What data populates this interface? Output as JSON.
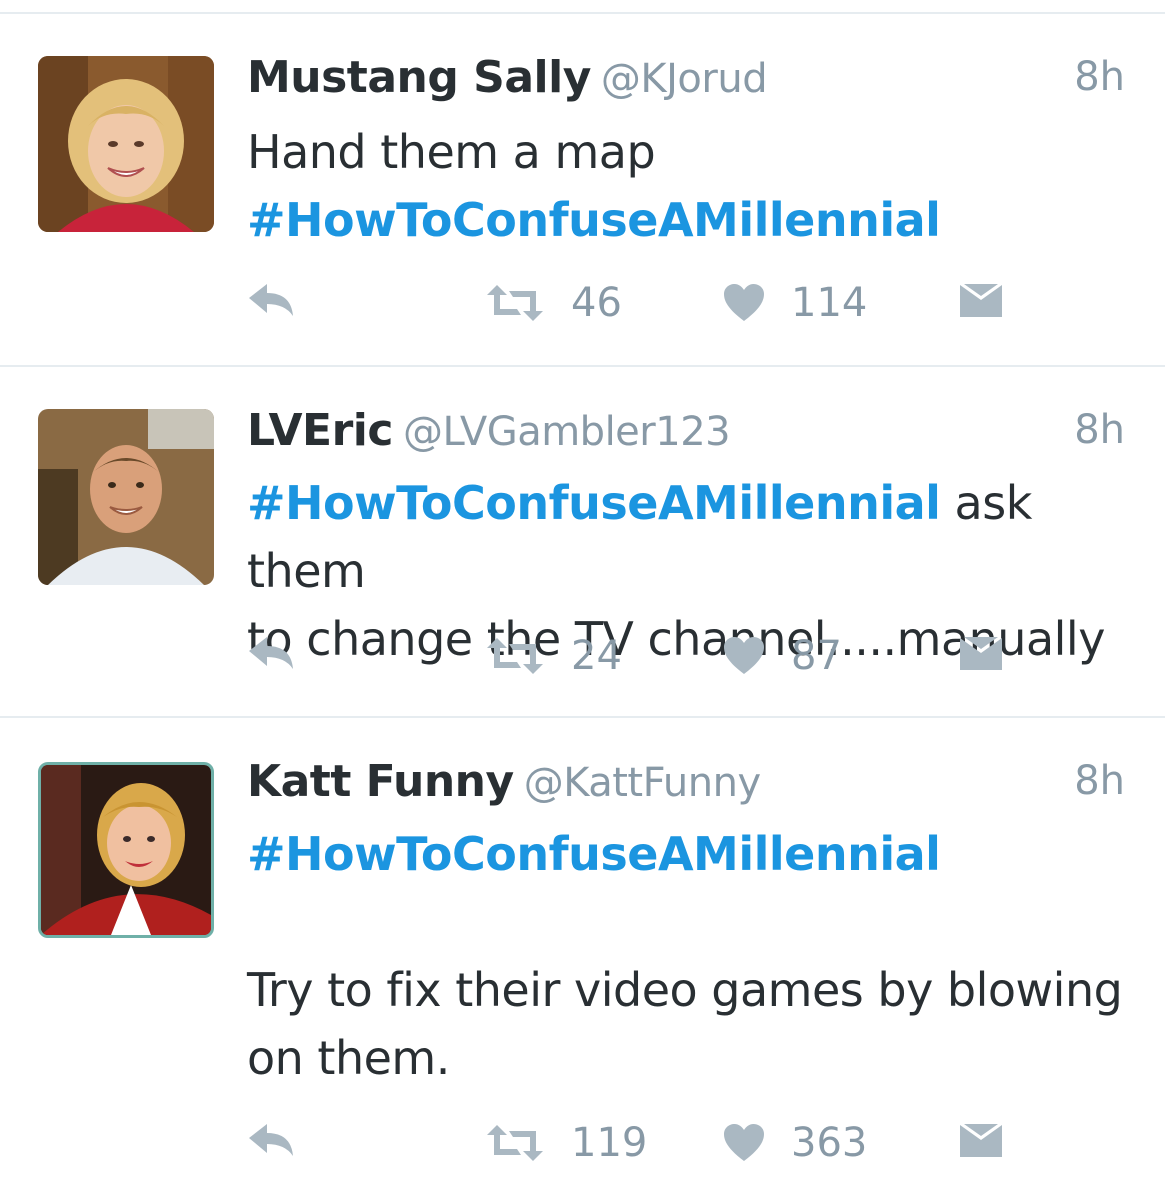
{
  "tweets": [
    {
      "name": "Mustang Sally",
      "handle": "@KJorud",
      "time": "8h",
      "lines": [
        {
          "parts": [
            {
              "text": "Hand them a map",
              "hashtag": false
            }
          ]
        },
        {
          "parts": [
            {
              "text": "#HowToConfuseAMillennial",
              "hashtag": true
            }
          ]
        }
      ],
      "retweets": "46",
      "likes": "114"
    },
    {
      "name": "LVEric",
      "handle": "@LVGambler123",
      "time": "8h",
      "lines": [
        {
          "parts": [
            {
              "text": "#HowToConfuseAMillennial",
              "hashtag": true
            },
            {
              "text": " ask them",
              "hashtag": false
            }
          ]
        },
        {
          "parts": [
            {
              "text": "to change the TV channel.....manually",
              "hashtag": false
            }
          ]
        }
      ],
      "retweets": "24",
      "likes": "87"
    },
    {
      "name": "Katt Funny",
      "handle": "@KattFunny",
      "time": "8h",
      "lines": [
        {
          "parts": [
            {
              "text": "#HowToConfuseAMillennial",
              "hashtag": true
            }
          ]
        },
        {
          "parts": [
            {
              "text": "",
              "hashtag": false
            }
          ]
        },
        {
          "parts": [
            {
              "text": "Try to fix their video games by blowing",
              "hashtag": false
            }
          ]
        },
        {
          "parts": [
            {
              "text": "on them.",
              "hashtag": false
            }
          ]
        }
      ],
      "retweets": "119",
      "likes": "363"
    }
  ],
  "icons": {
    "reply": "reply-icon",
    "retweet": "retweet-icon",
    "like": "heart-icon",
    "dm": "envelope-icon"
  },
  "colors": {
    "hashtag": "#1b95e0",
    "muted": "#8899a6",
    "action": "#aab8c2",
    "divider": "#e6ecf0"
  }
}
